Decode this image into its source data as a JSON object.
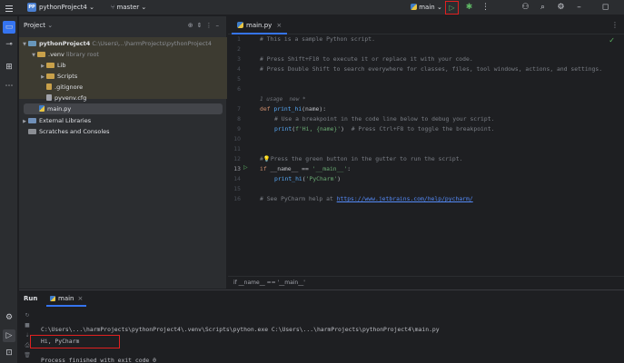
{
  "titlebar": {
    "project_badge": "PP",
    "project_name": "pythonProject4",
    "branch": "master",
    "run_config": "main"
  },
  "project_panel": {
    "title": "Project",
    "tree": [
      {
        "label": "pythonProject4",
        "path": "C:\\Users\\...\\harmProjects\\pythonProject4"
      },
      {
        "label": ".venv",
        "note": "library root"
      },
      {
        "label": "Lib"
      },
      {
        "label": "Scripts"
      },
      {
        "label": ".gitignore"
      },
      {
        "label": "pyvenv.cfg"
      },
      {
        "label": "main.py"
      },
      {
        "label": "External Libraries"
      },
      {
        "label": "Scratches and Consoles"
      }
    ]
  },
  "editor": {
    "tab": "main.py",
    "line_numbers": [
      "1",
      "2",
      "3",
      "4",
      "5",
      "6",
      "7",
      "8",
      "9",
      "10",
      "11",
      "12",
      "13",
      "14",
      "15",
      "16"
    ],
    "hint": "1 usage  new *",
    "lines": {
      "l1": "# This is a sample Python script.",
      "l3": "# Press Shift+F10 to execute it or replace it with your code.",
      "l4": "# Press Double Shift to search everywhere for classes, files, tool windows, actions, and settings.",
      "l7_kw": "def ",
      "l7_fn": "print_hi",
      "l7_rest": "(name):",
      "l8": "# Use a breakpoint in the code line below to debug your script.",
      "l9_fn": "print",
      "l9_p1": "(",
      "l9_st": "f'Hi, {name}'",
      "l9_p2": ")  ",
      "l9_cm": "# Press Ctrl+F8 to toggle the breakpoint.",
      "l12": "Press the green button in the gutter to run the script.",
      "l13_kw": "if ",
      "l13_mid": "__name__ == ",
      "l13_st": "'__main__'",
      "l13_end": ":",
      "l14_fn": "print_hi",
      "l14_p1": "(",
      "l14_st": "'PyCharm'",
      "l14_p2": ")",
      "l16_cm": "# See PyCharm help at ",
      "l16_link": "https://www.jetbrains.com/help/pycharm/"
    },
    "breadcrumb": "if __name__ == '__main__'"
  },
  "run_panel": {
    "title": "Run",
    "tab": "main",
    "output": [
      "C:\\Users\\...\\harmProjects\\pythonProject4\\.venv\\Scripts\\python.exe C:\\Users\\...\\harmProjects\\pythonProject4\\main.py",
      "Hi, PyCharm",
      "",
      "Process finished with exit code 0"
    ]
  },
  "colors": {
    "highlight_box": "#e02020",
    "run_green": "#5fb865",
    "accent": "#3574f0"
  }
}
